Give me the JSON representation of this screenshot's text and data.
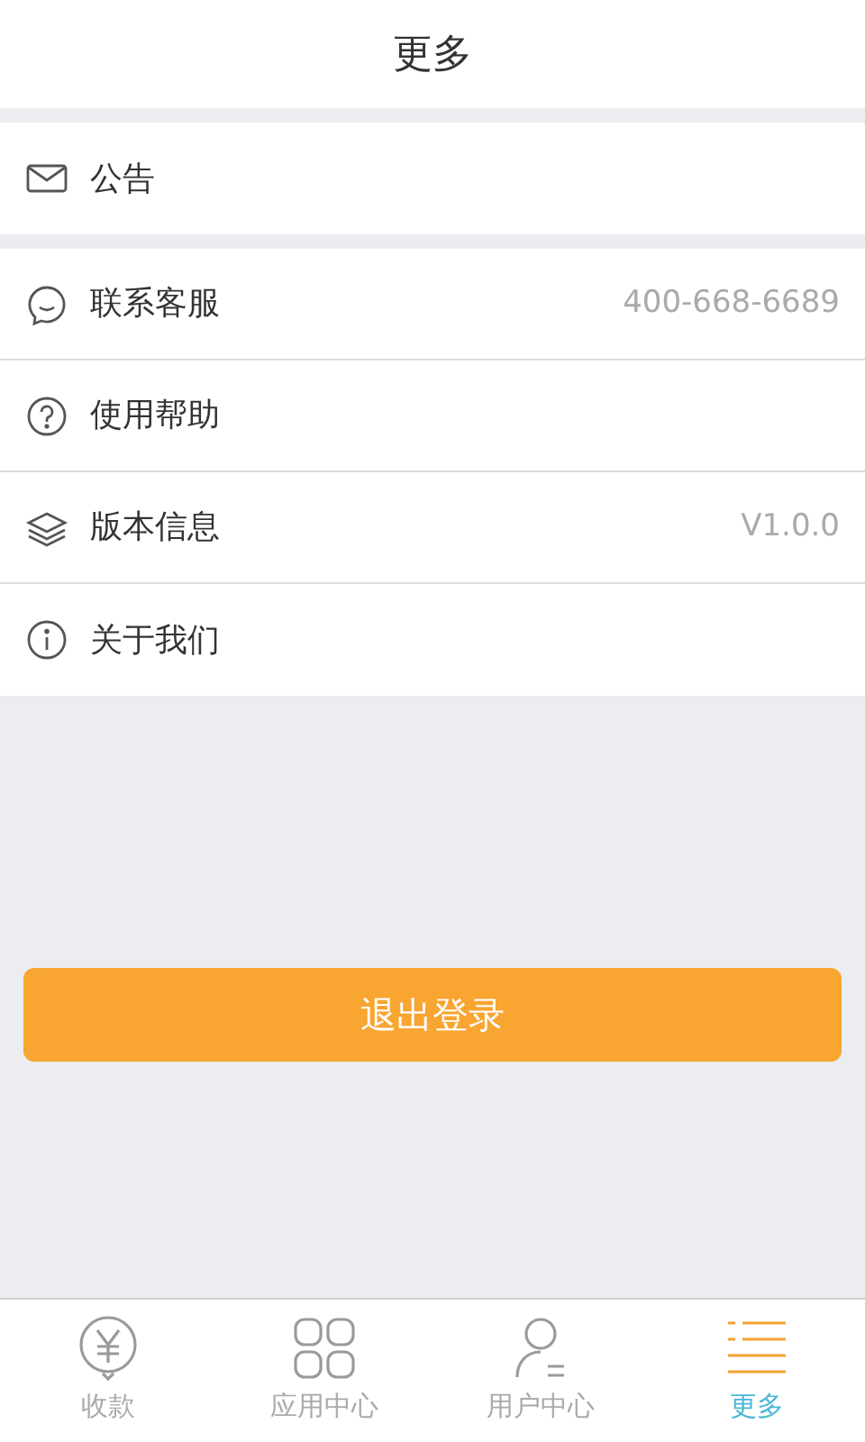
{
  "header": {
    "title": "更多"
  },
  "sections": [
    {
      "items": [
        {
          "kind": "mail",
          "label": "公告"
        }
      ]
    },
    {
      "items": [
        {
          "kind": "chat",
          "label": "联系客服",
          "value": "400-668-6689"
        },
        {
          "kind": "help",
          "label": "使用帮助"
        },
        {
          "kind": "layers",
          "label": "版本信息",
          "value": "V1.0.0"
        },
        {
          "kind": "info",
          "label": "关于我们"
        }
      ]
    }
  ],
  "logout_button": "退出登录",
  "tab_bar": [
    {
      "kind": "yen",
      "label": "收款",
      "selected": false
    },
    {
      "kind": "grid",
      "label": "应用中心",
      "selected": false
    },
    {
      "kind": "user",
      "label": "用户中心",
      "selected": false
    },
    {
      "kind": "list",
      "label": "更多",
      "selected": true
    }
  ]
}
